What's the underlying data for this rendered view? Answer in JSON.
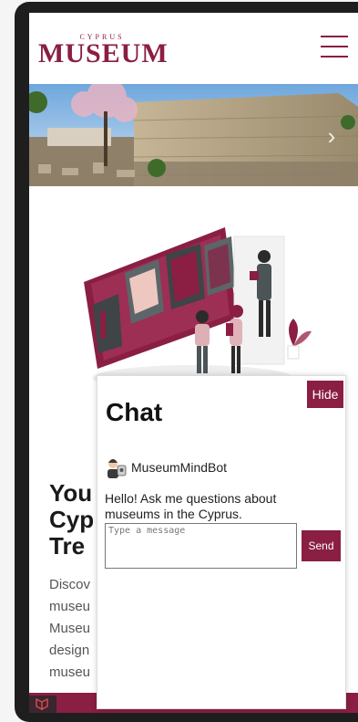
{
  "header": {
    "logo_small": "CYPRUS",
    "logo_main": "MUSEUM",
    "menu_icon": "hamburger-menu-icon"
  },
  "hero": {
    "next_icon": "chevron-right-icon",
    "next_glyph": "›"
  },
  "page": {
    "title": "Your Cyprus Treasure",
    "title_visible": [
      "You",
      "Cyp",
      "Tre"
    ],
    "desc_visible": [
      "Discov",
      "museu",
      "Museu",
      "design",
      "museu"
    ]
  },
  "chat": {
    "title": "Chat",
    "hide_label": "Hide",
    "bot_name": "MuseumMindBot",
    "bot_message": "Hello! Ask me questions about museums in the Cyprus.",
    "input_placeholder": "Type a message",
    "send_label": "Send"
  },
  "colors": {
    "brand": "#8a1e43",
    "frame": "#1e1e1e"
  }
}
